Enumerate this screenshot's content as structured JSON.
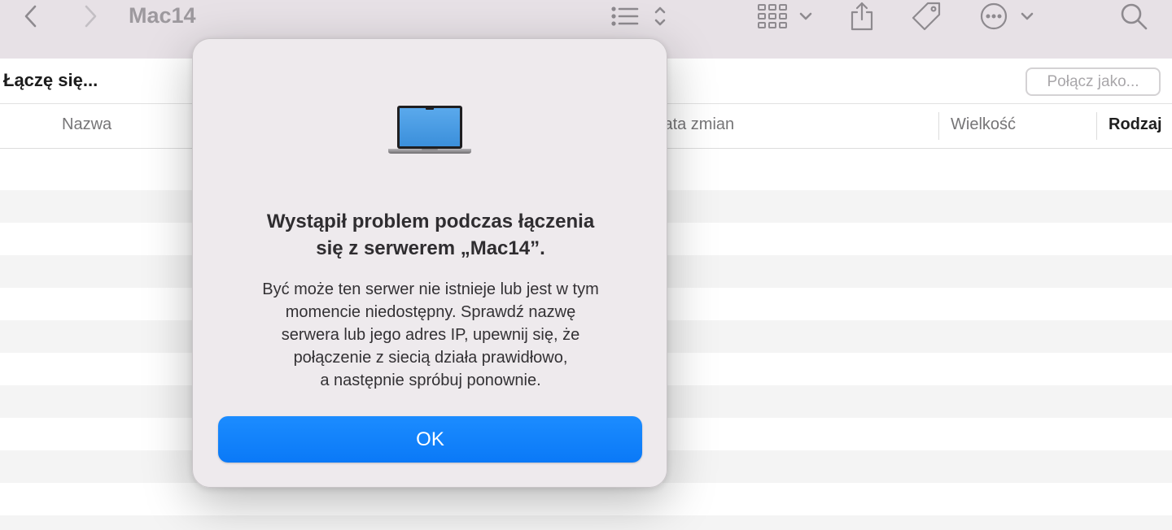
{
  "window": {
    "title": "Mac14"
  },
  "toolbar": {
    "icons": [
      "back-icon",
      "forward-icon",
      "list-view-icon",
      "sort-chevrons-icon",
      "icon-grid-icon",
      "share-icon",
      "tag-icon",
      "more-icon",
      "search-icon"
    ]
  },
  "pathbar": {
    "status": "Łączę się...",
    "connect_as_label": "Połącz jako..."
  },
  "columns": {
    "name": "Nazwa",
    "date": "Data zmian",
    "size": "Wielkość",
    "kind": "Rodzaj"
  },
  "dialog": {
    "icon": "laptop-icon",
    "title_lines": [
      "Wystąpił problem podczas łączenia",
      "się z serwerem „Mac14”."
    ],
    "message_lines": [
      "Być może ten serwer nie istnieje lub jest w tym",
      "momencie niedostępny. Sprawdź nazwę",
      "serwera lub jego adres IP, upewnij się, że",
      "połączenie z siecią działa prawidłowo,",
      "a następnie spróbuj ponownie."
    ],
    "ok_label": "OK"
  },
  "colors": {
    "toolbar_bg": "#e7e1e6",
    "dialog_bg": "#eeeaed",
    "accent": "#0a7cf8"
  }
}
